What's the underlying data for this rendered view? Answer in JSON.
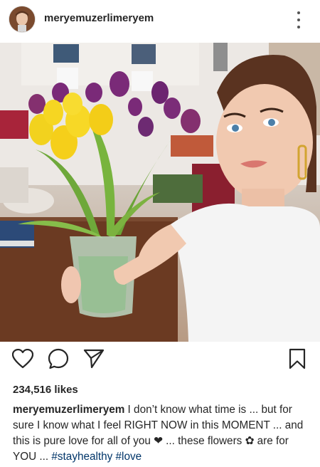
{
  "post": {
    "username": "meryemuzerlimeryem",
    "likes": "234,516 likes",
    "caption": {
      "username": "meryemuzerlimeryem",
      "text_1": " I don’t know what time is ... but for sure I know what I feel RIGHT NOW in this MOMENT ... and this is pure love for all of you ",
      "heart": "❤",
      "text_2": " ... these flowers ",
      "flower_emoji": "✿",
      "text_3": " are for YOU ... ",
      "hashtag_1": "#stayhealthy",
      "hashtag_2": "#love"
    }
  },
  "icons": {
    "like": "heart-outline-icon",
    "comment": "comment-bubble-icon",
    "share": "paper-plane-icon",
    "save": "bookmark-icon",
    "more": "more-vertical-icon"
  },
  "colors": {
    "hashtag": "#003569",
    "text": "#262626"
  }
}
